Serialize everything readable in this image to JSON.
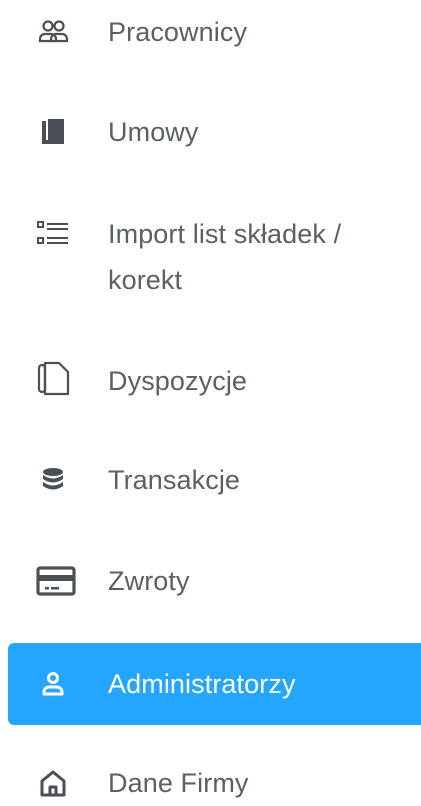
{
  "nav": {
    "items": [
      {
        "label": "Pracownicy",
        "icon": "users-icon"
      },
      {
        "label": "Umowy",
        "icon": "contracts-icon"
      },
      {
        "label": "Import list składek / korekt",
        "icon": "list-icon"
      },
      {
        "label": "Dyspozycje",
        "icon": "document-icon"
      },
      {
        "label": "Transakcje",
        "icon": "database-icon"
      },
      {
        "label": "Zwroty",
        "icon": "credit-card-icon"
      },
      {
        "label": "Administratorzy",
        "icon": "user-icon",
        "active": true
      },
      {
        "label": "Dane Firmy",
        "icon": "home-icon"
      }
    ]
  },
  "colors": {
    "active_background": "#24a5ff",
    "text": "#5b6066",
    "icon": "#4a5056",
    "active_text": "#ffffff"
  }
}
